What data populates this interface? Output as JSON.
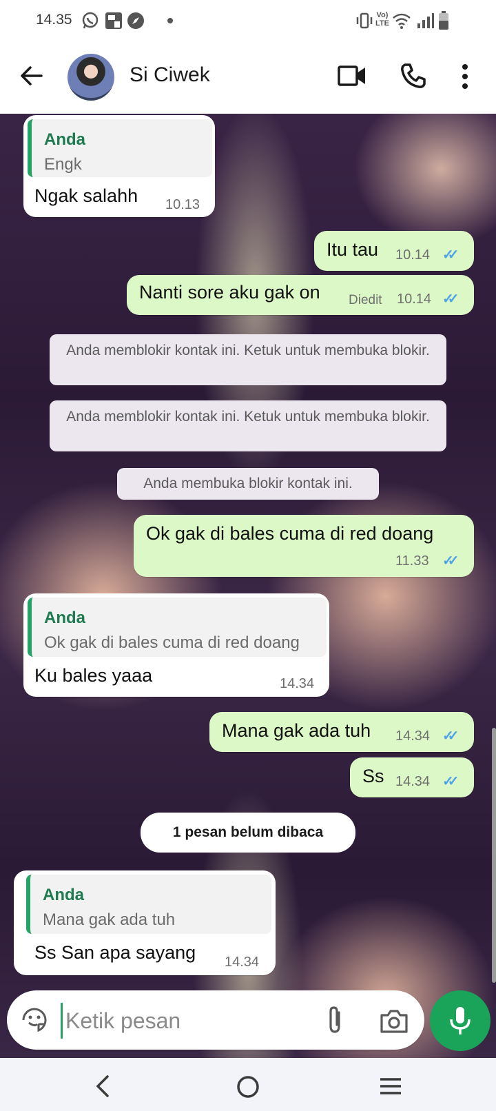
{
  "status_bar": {
    "time": "14.35",
    "icons": [
      "whatsapp-icon",
      "facebook-messenger-icon",
      "compass-icon",
      "dot-icon",
      "vibrate-icon",
      "volte-icon",
      "wifi-icon",
      "signal-icon",
      "battery-icon"
    ]
  },
  "header": {
    "contact_name": "Si Ciwek",
    "icons": [
      "back-arrow-icon",
      "video-call-icon",
      "phone-icon",
      "more-vert-icon"
    ]
  },
  "messages": [
    {
      "dir": "in",
      "quote_author": "Anda",
      "quote_text": "Engk",
      "text": "Ngak salahh",
      "time": "10.13"
    },
    {
      "dir": "out",
      "text": "Itu tau",
      "time": "10.14",
      "ticks": "read"
    },
    {
      "dir": "out",
      "text": "Nanti sore aku gak on",
      "edited": "Diedit",
      "time": "10.14",
      "ticks": "read"
    },
    {
      "dir": "out",
      "text": "Ok gak di bales cuma di red doang",
      "time": "11.33",
      "ticks": "read"
    },
    {
      "dir": "in",
      "quote_author": "Anda",
      "quote_text": "Ok gak di bales cuma di red doang",
      "text": "Ku  bales yaaa",
      "time": "14.34"
    },
    {
      "dir": "out",
      "text": "Mana gak ada tuh",
      "time": "14.34",
      "ticks": "read"
    },
    {
      "dir": "out",
      "text": "Ss",
      "time": "14.34",
      "ticks": "read"
    },
    {
      "dir": "in",
      "quote_author": "Anda",
      "quote_text": "Mana gak ada tuh",
      "text": "Ss San apa sayang",
      "time": "14.34"
    }
  ],
  "system": {
    "blocked_1": "Anda memblokir kontak ini. Ketuk untuk membuka blokir.",
    "blocked_2": "Anda memblokir kontak ini. Ketuk untuk membuka blokir.",
    "unblocked": "Anda membuka blokir kontak ini.",
    "unread": "1 pesan belum dibaca"
  },
  "input": {
    "placeholder": "Ketik pesan",
    "icons": [
      "sticker-icon",
      "attach-icon",
      "camera-icon",
      "mic-icon"
    ]
  },
  "colors": {
    "outgoing_bubble": "#dcf8c6",
    "incoming_bubble": "#ffffff",
    "accent_green": "#19a45a",
    "read_ticks": "#4fa3e8"
  },
  "nav_bar": {
    "icons": [
      "nav-back-icon",
      "nav-home-icon",
      "nav-recents-icon"
    ]
  }
}
